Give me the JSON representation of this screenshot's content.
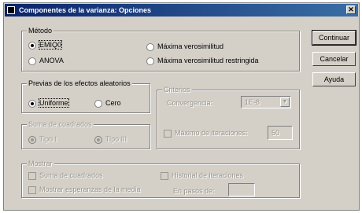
{
  "window": {
    "title": "Componentes de la varianza: Opciones"
  },
  "icons": {
    "app": "spss-window-icon",
    "close": "close-icon",
    "dropdown": "chevron-down-icon"
  },
  "metodo": {
    "legend": "Método",
    "options": [
      "EMIQ0",
      "ANOVA",
      "Máxima verosimilitud",
      "Máxima verosimilitud restringida"
    ],
    "selected": "EMIQ0"
  },
  "previas": {
    "legend": "Previas de los efectos aleatorios",
    "options": [
      "Uniforme",
      "Cero"
    ],
    "selected": "Uniforme"
  },
  "criterios": {
    "legend": "Criterios",
    "convergencia_label": "Convergencia:",
    "convergencia_value": "1E-8",
    "iteraciones_label": "Máximo de iteraciones:",
    "iteraciones_value": "50"
  },
  "suma_cuadrados": {
    "legend": "Suma de cuadrados",
    "options": [
      "Tipo I",
      "Tipo III"
    ],
    "selected": "Tipo I"
  },
  "mostrar": {
    "legend": "Mostrar",
    "items": [
      "Suma de cuadrados",
      "Mostrar esperanzas de la media",
      "Historial de iteraciones"
    ],
    "en_pasos_label": "En pasos de:",
    "en_pasos_value": ""
  },
  "buttons": {
    "continuar": "Continuar",
    "cancelar": "Cancelar",
    "ayuda": "Ayuda"
  }
}
